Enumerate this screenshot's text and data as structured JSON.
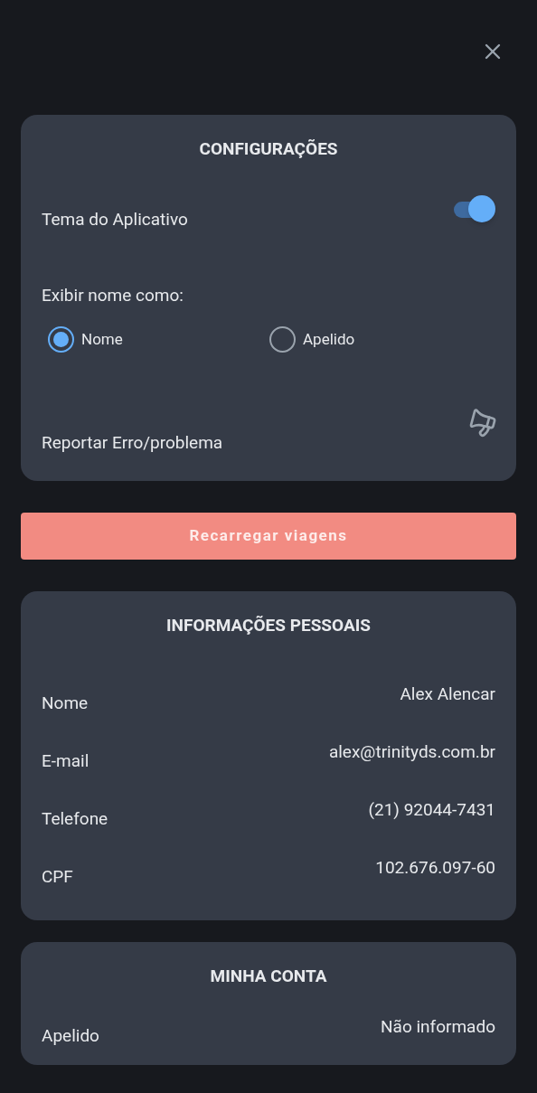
{
  "settings": {
    "title": "CONFIGURAÇÕES",
    "theme": {
      "label": "Tema do Aplicativo",
      "on": true
    },
    "display_name": {
      "label": "Exibir nome como:",
      "options": [
        {
          "label": "Nome",
          "selected": true
        },
        {
          "label": "Apelido",
          "selected": false
        }
      ]
    },
    "report": {
      "label": "Reportar Erro/problema"
    }
  },
  "reload_button": "Recarregar viagens",
  "personal_info": {
    "title": "INFORMAÇÕES PESSOAIS",
    "rows": [
      {
        "label": "Nome",
        "value": "Alex Alencar"
      },
      {
        "label": "E-mail",
        "value": "alex@trinityds.com.br"
      },
      {
        "label": "Telefone",
        "value": "(21) 92044-7431"
      },
      {
        "label": "CPF",
        "value": "102.676.097-60"
      }
    ]
  },
  "account": {
    "title": "MINHA CONTA",
    "rows": [
      {
        "label": "Apelido",
        "value": "Não informado"
      }
    ]
  }
}
